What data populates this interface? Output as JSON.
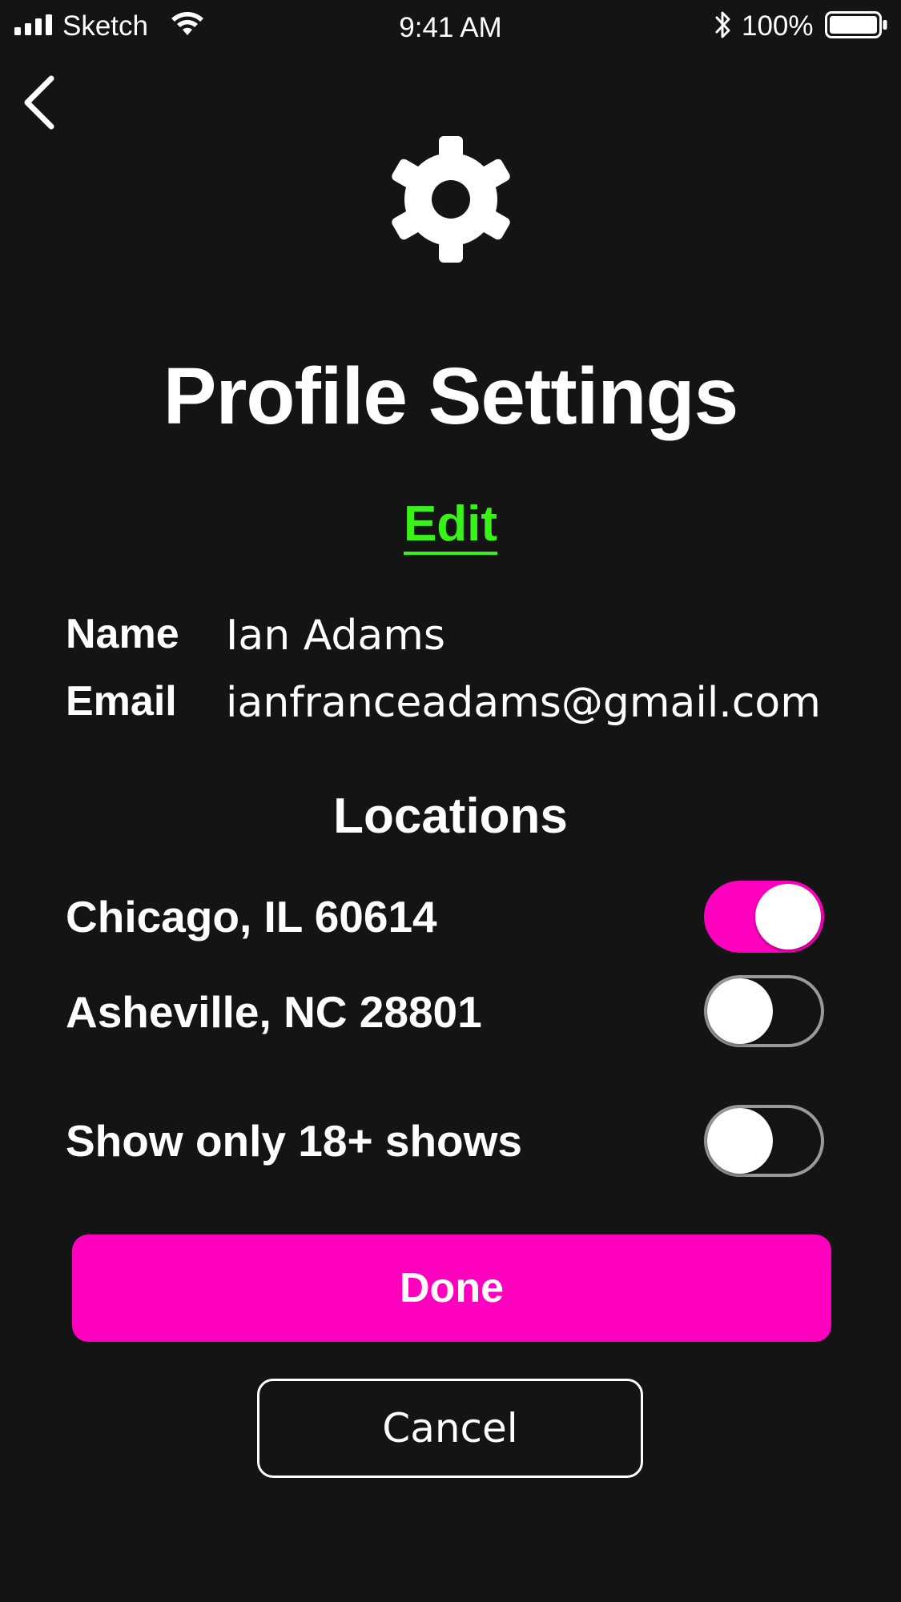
{
  "status_bar": {
    "carrier": "Sketch",
    "time": "9:41 AM",
    "battery": "100%"
  },
  "nav": {
    "back_icon": "chevron-left-icon"
  },
  "header": {
    "icon": "gear-icon",
    "title": "Profile Settings",
    "edit_label": "Edit"
  },
  "profile": {
    "name_label": "Name",
    "name_value": "Ian Adams",
    "email_label": "Email",
    "email_value": "ianfranceadams@gmail.com"
  },
  "locations": {
    "title": "Locations",
    "items": [
      {
        "label": "Chicago, IL 60614",
        "enabled": true
      },
      {
        "label": "Asheville, NC 28801",
        "enabled": false
      }
    ]
  },
  "preferences": {
    "adult_shows_label": "Show only 18+ shows",
    "adult_shows_enabled": false
  },
  "actions": {
    "done_label": "Done",
    "cancel_label": "Cancel"
  },
  "colors": {
    "background": "#141414",
    "accent": "#ff00bf",
    "edit_link": "#39f21a",
    "toggle_off_border": "#9a9a9a"
  }
}
